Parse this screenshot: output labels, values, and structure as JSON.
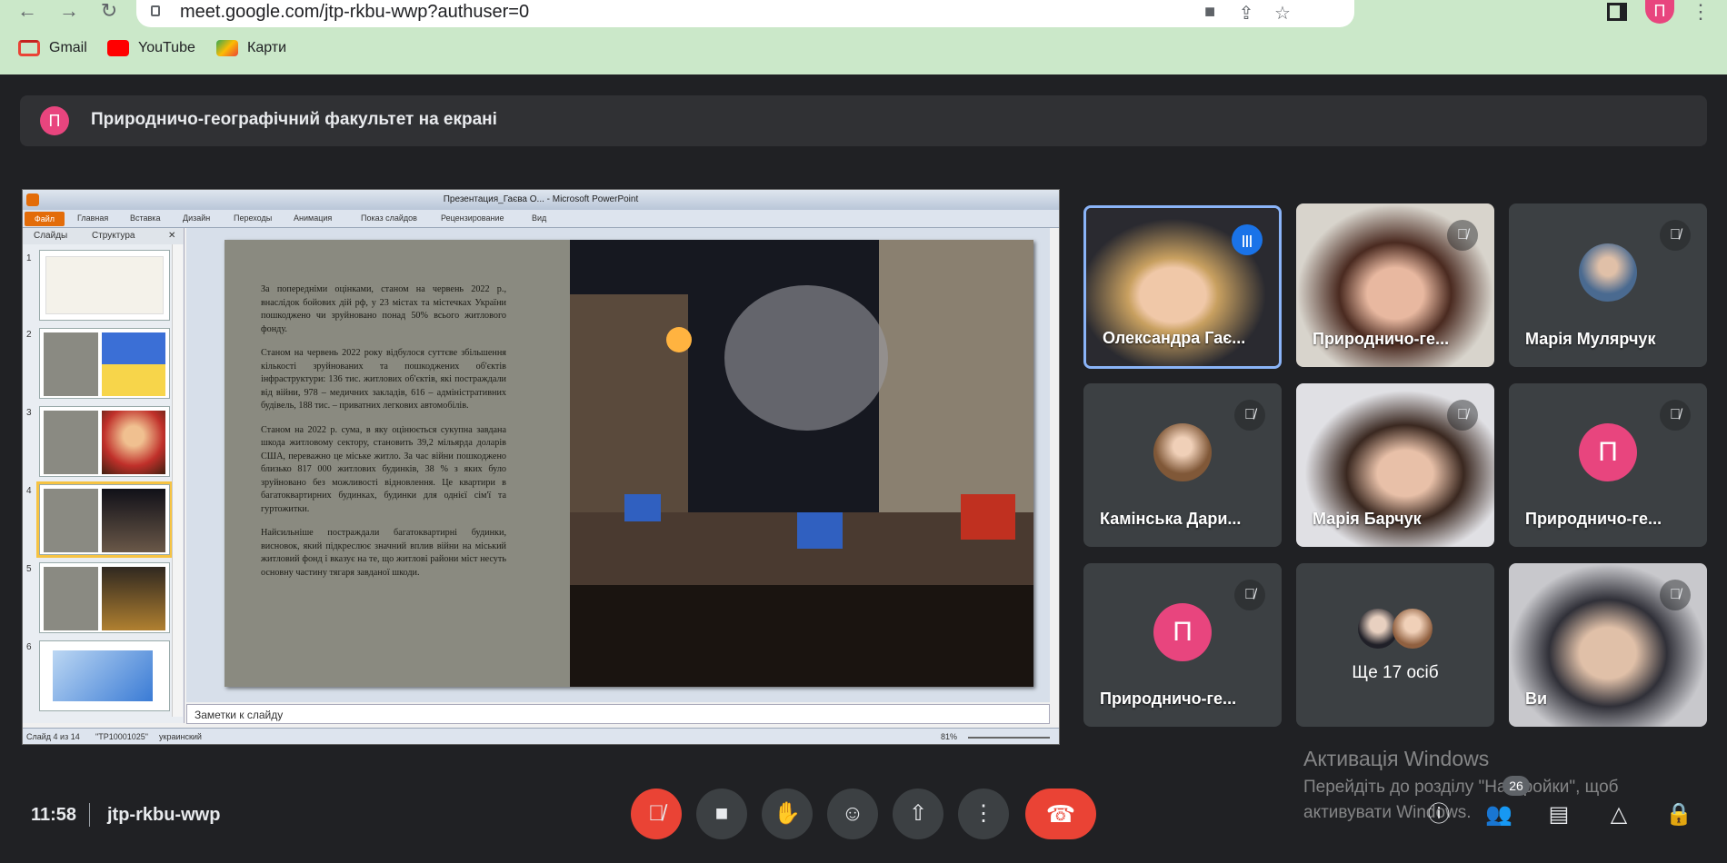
{
  "browser": {
    "url": "meet.google.com/jtp-rkbu-wwp?authuser=0",
    "profile_initial": "П",
    "bookmarks": [
      {
        "label": "Gmail",
        "color": "#ea4335"
      },
      {
        "label": "YouTube",
        "color": "#ff0000"
      },
      {
        "label": "Карти",
        "color": "#34a853"
      }
    ]
  },
  "banner": {
    "avatar_initial": "П",
    "text": "Природничо-географічний факультет на екрані"
  },
  "presentation": {
    "window_title": "Презентация_Гаєва О... - Microsoft PowerPoint",
    "file_tab": "Файл",
    "ribbon_tabs": [
      "Главная",
      "Вставка",
      "Дизайн",
      "Переходы",
      "Анимация",
      "Показ слайдов",
      "Рецензирование",
      "Вид"
    ],
    "panel_tabs": [
      "Слайды",
      "Структура"
    ],
    "thumb_numbers": [
      "1",
      "2",
      "3",
      "4",
      "5",
      "6"
    ],
    "slide_paragraphs": [
      "За попередніми оцінками, станом на червень 2022 р., внаслідок бойових дій рф, у 23 містах та містечках України пошкоджено чи зруйновано понад 50% всього житлового фонду.",
      "Станом на червень 2022 року відбулося суттєве збільшення кількості зруйнованих та пошкоджених об'єктів інфраструктури: 136 тис. житлових об'єктів, які постраждали від війни, 978 – медичних закладів, 616 – адміністративних будівель, 188 тис. – приватних легкових автомобілів.",
      "Станом на 2022 р. сума, в яку оцінюється сукупна завдана шкода житловому сектору, становить 39,2 мільярда доларів США, переважно це міське житло. За час війни пошкоджено близько 817 000 житлових будинків, 38 % з яких було зруйновано без можливості відновлення. Це квартири в багатоквартирних будинках, будинки для однієї сім'ї та гуртожитки.",
      "Найсильніше постраждали багатоквартирні будинки, висновок, який підкреслює значний вплив війни на міський житловий фонд і вказує на те, що житлові райони міст несуть основну частину тягаря завданої шкоди."
    ],
    "notes_placeholder": "Заметки к слайду",
    "status": {
      "slide_counter": "Слайд 4 из 14",
      "theme": "\"TP10001025\"",
      "language": "украинский",
      "zoom": "81%"
    }
  },
  "participants": [
    {
      "name": "Олександра Гає...",
      "state": "speaking",
      "active": true,
      "kind": "video"
    },
    {
      "name": "Природничо-ге...",
      "state": "muted",
      "kind": "video"
    },
    {
      "name": "Марія Мулярчук",
      "state": "muted",
      "kind": "photo"
    },
    {
      "name": "Камінська Дари...",
      "state": "muted",
      "kind": "photo"
    },
    {
      "name": "Марія Барчук",
      "state": "muted",
      "kind": "video"
    },
    {
      "name": "Природничо-ге...",
      "state": "muted",
      "kind": "initial",
      "initial": "П"
    },
    {
      "name": "Природничо-ге...",
      "state": "muted",
      "kind": "initial",
      "initial": "П"
    },
    {
      "name": "Ще 17 осіб",
      "state": "none",
      "kind": "group"
    },
    {
      "name": "Ви",
      "state": "muted",
      "kind": "video"
    }
  ],
  "watermark": {
    "title": "Активація Windows",
    "line1": "Перейдіть до розділу \"Настройки\", щоб",
    "line2": "активувати Windows."
  },
  "meeting": {
    "time": "11:58",
    "code": "jtp-rkbu-wwp",
    "participant_count": "26"
  },
  "colors": {
    "accent_red": "#ea4335",
    "avatar_pink": "#e8457e",
    "speaking_blue": "#1a73e8",
    "chrome_green": "#cbe8c9"
  }
}
